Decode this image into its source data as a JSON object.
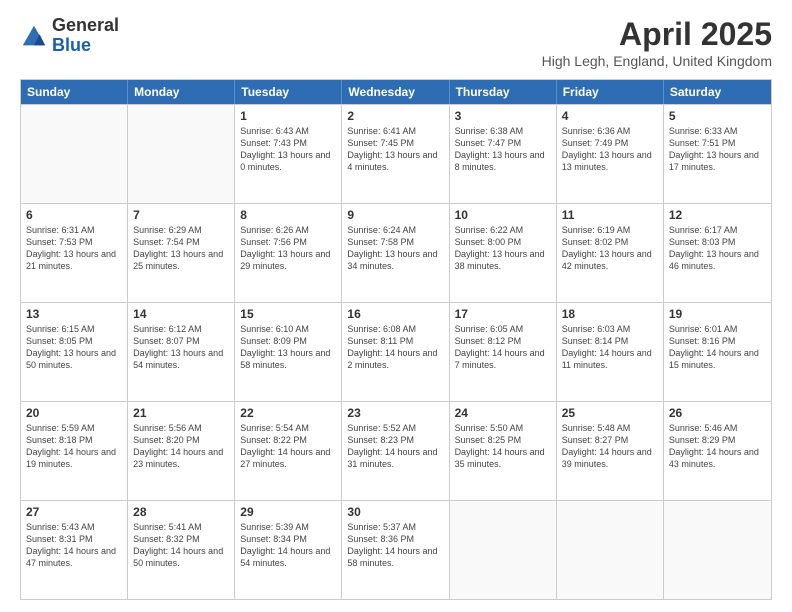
{
  "logo": {
    "general": "General",
    "blue": "Blue"
  },
  "title": "April 2025",
  "subtitle": "High Legh, England, United Kingdom",
  "days_of_week": [
    "Sunday",
    "Monday",
    "Tuesday",
    "Wednesday",
    "Thursday",
    "Friday",
    "Saturday"
  ],
  "weeks": [
    [
      {
        "day": "",
        "info": ""
      },
      {
        "day": "",
        "info": ""
      },
      {
        "day": "1",
        "info": "Sunrise: 6:43 AM\nSunset: 7:43 PM\nDaylight: 13 hours and 0 minutes."
      },
      {
        "day": "2",
        "info": "Sunrise: 6:41 AM\nSunset: 7:45 PM\nDaylight: 13 hours and 4 minutes."
      },
      {
        "day": "3",
        "info": "Sunrise: 6:38 AM\nSunset: 7:47 PM\nDaylight: 13 hours and 8 minutes."
      },
      {
        "day": "4",
        "info": "Sunrise: 6:36 AM\nSunset: 7:49 PM\nDaylight: 13 hours and 13 minutes."
      },
      {
        "day": "5",
        "info": "Sunrise: 6:33 AM\nSunset: 7:51 PM\nDaylight: 13 hours and 17 minutes."
      }
    ],
    [
      {
        "day": "6",
        "info": "Sunrise: 6:31 AM\nSunset: 7:53 PM\nDaylight: 13 hours and 21 minutes."
      },
      {
        "day": "7",
        "info": "Sunrise: 6:29 AM\nSunset: 7:54 PM\nDaylight: 13 hours and 25 minutes."
      },
      {
        "day": "8",
        "info": "Sunrise: 6:26 AM\nSunset: 7:56 PM\nDaylight: 13 hours and 29 minutes."
      },
      {
        "day": "9",
        "info": "Sunrise: 6:24 AM\nSunset: 7:58 PM\nDaylight: 13 hours and 34 minutes."
      },
      {
        "day": "10",
        "info": "Sunrise: 6:22 AM\nSunset: 8:00 PM\nDaylight: 13 hours and 38 minutes."
      },
      {
        "day": "11",
        "info": "Sunrise: 6:19 AM\nSunset: 8:02 PM\nDaylight: 13 hours and 42 minutes."
      },
      {
        "day": "12",
        "info": "Sunrise: 6:17 AM\nSunset: 8:03 PM\nDaylight: 13 hours and 46 minutes."
      }
    ],
    [
      {
        "day": "13",
        "info": "Sunrise: 6:15 AM\nSunset: 8:05 PM\nDaylight: 13 hours and 50 minutes."
      },
      {
        "day": "14",
        "info": "Sunrise: 6:12 AM\nSunset: 8:07 PM\nDaylight: 13 hours and 54 minutes."
      },
      {
        "day": "15",
        "info": "Sunrise: 6:10 AM\nSunset: 8:09 PM\nDaylight: 13 hours and 58 minutes."
      },
      {
        "day": "16",
        "info": "Sunrise: 6:08 AM\nSunset: 8:11 PM\nDaylight: 14 hours and 2 minutes."
      },
      {
        "day": "17",
        "info": "Sunrise: 6:05 AM\nSunset: 8:12 PM\nDaylight: 14 hours and 7 minutes."
      },
      {
        "day": "18",
        "info": "Sunrise: 6:03 AM\nSunset: 8:14 PM\nDaylight: 14 hours and 11 minutes."
      },
      {
        "day": "19",
        "info": "Sunrise: 6:01 AM\nSunset: 8:16 PM\nDaylight: 14 hours and 15 minutes."
      }
    ],
    [
      {
        "day": "20",
        "info": "Sunrise: 5:59 AM\nSunset: 8:18 PM\nDaylight: 14 hours and 19 minutes."
      },
      {
        "day": "21",
        "info": "Sunrise: 5:56 AM\nSunset: 8:20 PM\nDaylight: 14 hours and 23 minutes."
      },
      {
        "day": "22",
        "info": "Sunrise: 5:54 AM\nSunset: 8:22 PM\nDaylight: 14 hours and 27 minutes."
      },
      {
        "day": "23",
        "info": "Sunrise: 5:52 AM\nSunset: 8:23 PM\nDaylight: 14 hours and 31 minutes."
      },
      {
        "day": "24",
        "info": "Sunrise: 5:50 AM\nSunset: 8:25 PM\nDaylight: 14 hours and 35 minutes."
      },
      {
        "day": "25",
        "info": "Sunrise: 5:48 AM\nSunset: 8:27 PM\nDaylight: 14 hours and 39 minutes."
      },
      {
        "day": "26",
        "info": "Sunrise: 5:46 AM\nSunset: 8:29 PM\nDaylight: 14 hours and 43 minutes."
      }
    ],
    [
      {
        "day": "27",
        "info": "Sunrise: 5:43 AM\nSunset: 8:31 PM\nDaylight: 14 hours and 47 minutes."
      },
      {
        "day": "28",
        "info": "Sunrise: 5:41 AM\nSunset: 8:32 PM\nDaylight: 14 hours and 50 minutes."
      },
      {
        "day": "29",
        "info": "Sunrise: 5:39 AM\nSunset: 8:34 PM\nDaylight: 14 hours and 54 minutes."
      },
      {
        "day": "30",
        "info": "Sunrise: 5:37 AM\nSunset: 8:36 PM\nDaylight: 14 hours and 58 minutes."
      },
      {
        "day": "",
        "info": ""
      },
      {
        "day": "",
        "info": ""
      },
      {
        "day": "",
        "info": ""
      }
    ]
  ]
}
